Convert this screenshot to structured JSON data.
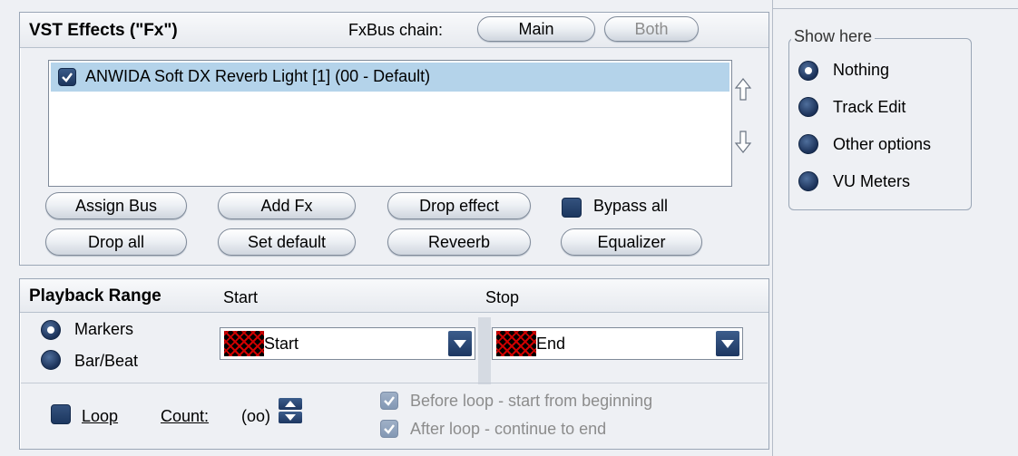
{
  "fx": {
    "title": "VST Effects (\"Fx\")",
    "bus_chain_label": "FxBus chain:",
    "bus_main": "Main",
    "bus_both": "Both",
    "effects": [
      {
        "name": "ANWIDA Soft DX Reverb Light [1] (00 - Default)",
        "enabled": true,
        "selected": true
      }
    ],
    "buttons": {
      "assign_bus": "Assign Bus",
      "add_fx": "Add Fx",
      "drop_effect": "Drop effect",
      "bypass_all": "Bypass all",
      "drop_all": "Drop all",
      "set_default": "Set default",
      "reverb": "Reveerb",
      "equalizer": "Equalizer"
    },
    "icons": {
      "move_up": "arrow-up-outline-icon",
      "move_down": "arrow-down-outline-icon"
    }
  },
  "playback": {
    "title": "Playback Range",
    "start_label": "Start",
    "stop_label": "Stop",
    "mode_markers": "Markers",
    "mode_barbeat": "Bar/Beat",
    "selected_mode": "Markers",
    "start_value": "Start",
    "stop_value": "End",
    "loop_label": "Loop",
    "loop_checked": false,
    "count_label": "Count:",
    "count_value": "(oo)",
    "before_loop": "Before loop - start from beginning",
    "after_loop": "After loop - continue to end"
  },
  "show_here": {
    "title": "Show here",
    "options": [
      "Nothing",
      "Track Edit",
      "Other options",
      "VU Meters"
    ],
    "selected": "Nothing"
  },
  "colors": {
    "accent_dark_blue": "#1d3761",
    "selection": "#b4d3ea",
    "panel_bg": "#eef0f4",
    "swatch_red": "#d00000"
  }
}
